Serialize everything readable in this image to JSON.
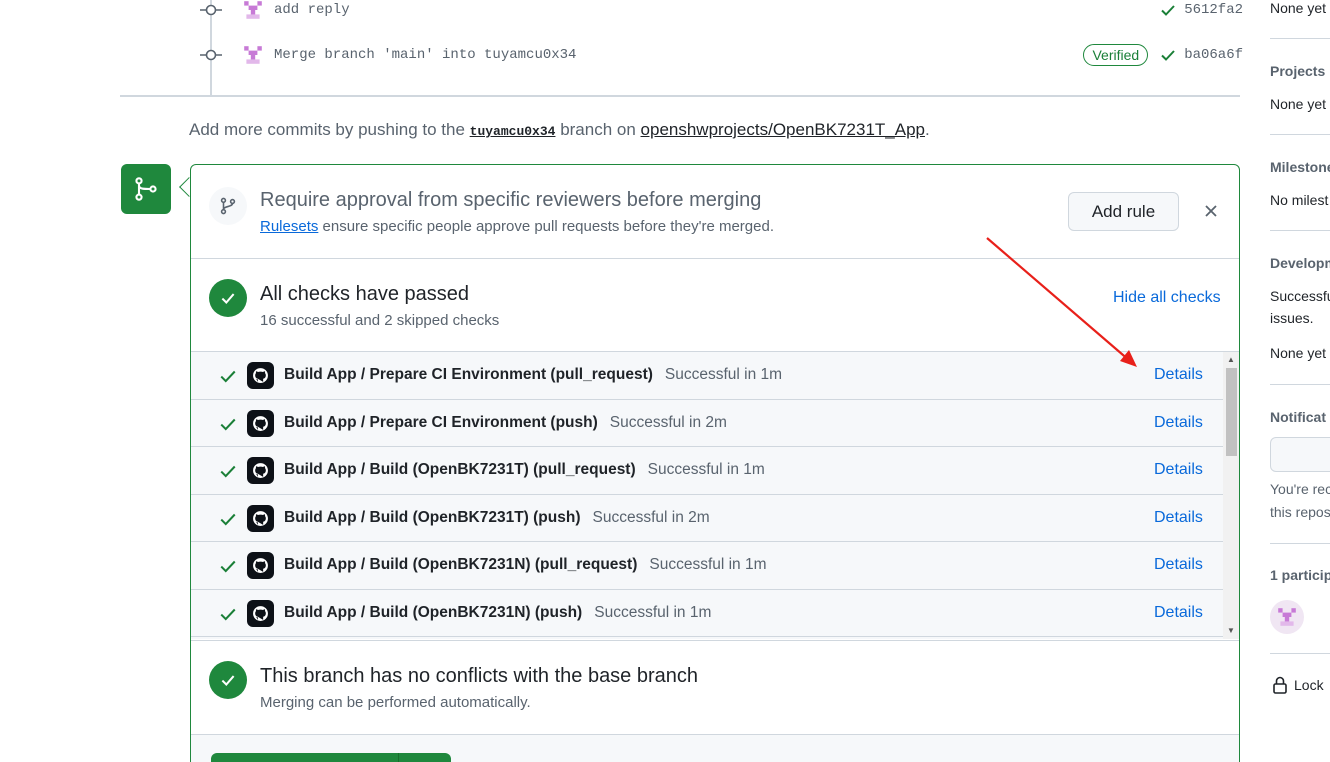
{
  "commits": [
    {
      "message": "add reply",
      "sha": "5612fa2",
      "verified": false
    },
    {
      "message": "Merge branch 'main' into tuyamcu0x34",
      "sha": "ba06a6f",
      "verified": true,
      "verified_label": "Verified"
    }
  ],
  "hint": {
    "prefix": "Add more commits by pushing to the ",
    "branch": "tuyamcu0x34",
    "middle": " branch on ",
    "repo": "openshwprojects/OpenBK7231T_App",
    "suffix": "."
  },
  "rule_banner": {
    "title": "Require approval from specific reviewers before merging",
    "link": "Rulesets",
    "desc": " ensure specific people approve pull requests before they're merged.",
    "add_rule_label": "Add rule"
  },
  "checks_summary": {
    "title": "All checks have passed",
    "subtitle": "16 successful and 2 skipped checks",
    "hide_label": "Hide all checks"
  },
  "checks": [
    {
      "name": "Build App / Prepare CI Environment (pull_request)",
      "status": "Successful in 1m",
      "details": "Details"
    },
    {
      "name": "Build App / Prepare CI Environment (push)",
      "status": "Successful in 2m",
      "details": "Details"
    },
    {
      "name": "Build App / Build (OpenBK7231T) (pull_request)",
      "status": "Successful in 1m",
      "details": "Details"
    },
    {
      "name": "Build App / Build (OpenBK7231T) (push)",
      "status": "Successful in 2m",
      "details": "Details"
    },
    {
      "name": "Build App / Build (OpenBK7231N) (pull_request)",
      "status": "Successful in 1m",
      "details": "Details"
    },
    {
      "name": "Build App / Build (OpenBK7231N) (push)",
      "status": "Successful in 1m",
      "details": "Details"
    }
  ],
  "no_conflicts": {
    "title": "This branch has no conflicts with the base branch",
    "subtitle": "Merging can be performed automatically."
  },
  "sidebar": {
    "reviewers_value": "None yet",
    "projects_head": "Projects",
    "projects_value": "None yet",
    "milestone_head": "Milestone",
    "milestone_value": "No milest",
    "development_head": "Developm",
    "development_text1": "Successfu",
    "development_text2": "issues.",
    "development_value": "None yet",
    "notifications_head": "Notificat",
    "notif_text1": "You're rec",
    "notif_text2": "this repos",
    "participants_head": "1 particip",
    "lock_label": "Lock"
  },
  "colors": {
    "accent_green": "#1f883d",
    "link_blue": "#0969da",
    "annotation_red": "#e8201a"
  }
}
